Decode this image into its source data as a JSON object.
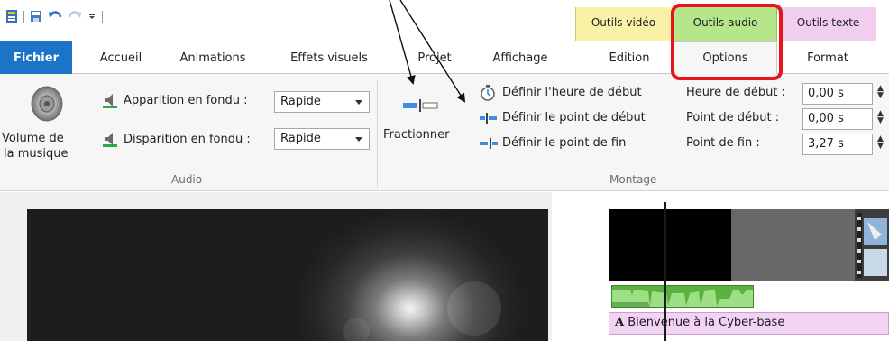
{
  "contextual_tabs": {
    "video": "Outils vidéo",
    "audio": "Outils audio",
    "texte": "Outils texte"
  },
  "tabs": {
    "fichier": "Fichier",
    "accueil": "Accueil",
    "animations": "Animations",
    "effets": "Effets visuels",
    "projet": "Projet",
    "affichage": "Affichage",
    "edition": "Edition",
    "options": "Options",
    "format": "Format"
  },
  "audio_group": {
    "volume_label_1": "Volume de",
    "volume_label_2": "la musique",
    "fade_in_label": "Apparition en fondu :",
    "fade_in_value": "Rapide",
    "fade_out_label": "Disparition en fondu :",
    "fade_out_value": "Rapide",
    "group_label": "Audio"
  },
  "montage_group": {
    "split_label": "Fractionner",
    "set_start_time": "Définir l'heure de début",
    "set_start_point": "Définir le point de début",
    "set_end_point": "Définir le point de fin",
    "start_time_label": "Heure de début :",
    "start_time_value": "0,00 s",
    "start_point_label": "Point de début :",
    "start_point_value": "0,00 s",
    "end_point_label": "Point de fin :",
    "end_point_value": "3,27 s",
    "group_label": "Montage"
  },
  "storyboard": {
    "text_clip": "Bienvenue à la Cyber-base",
    "text_icon": "A"
  },
  "colors": {
    "file_tab": "#1c74c8",
    "ctx_video": "#f8f1a6",
    "ctx_audio": "#b6e68a",
    "ctx_texte": "#f1cdf0",
    "highlight": "#e8141c"
  }
}
